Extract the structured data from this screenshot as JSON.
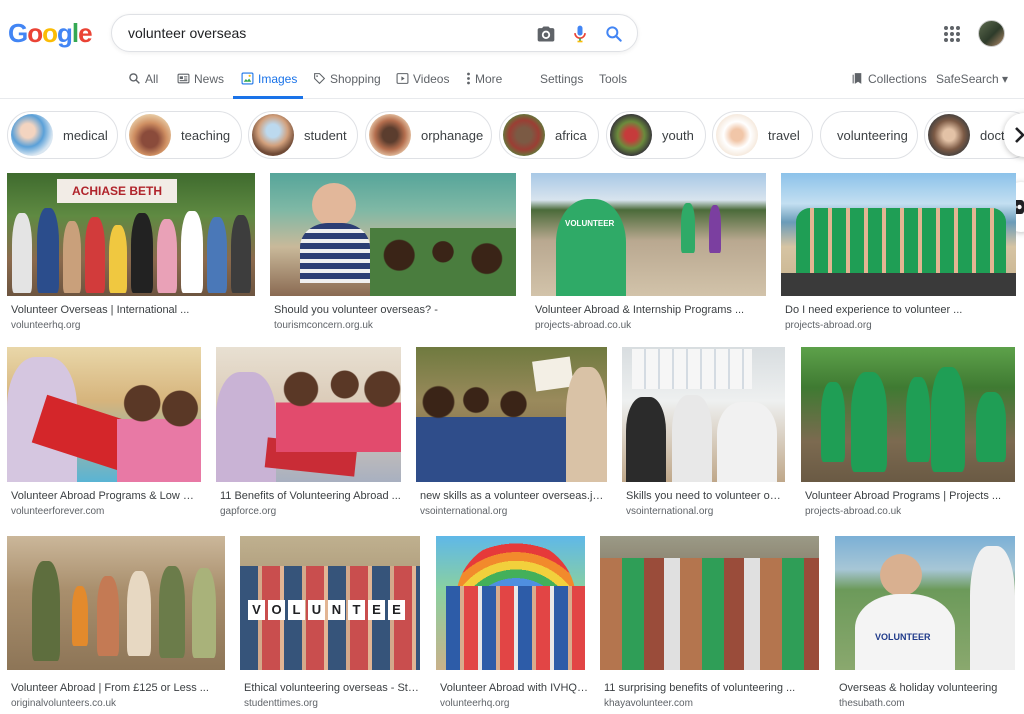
{
  "search": {
    "query": "volunteer overseas"
  },
  "logo": {
    "letters": [
      "G",
      "o",
      "o",
      "g",
      "l",
      "e"
    ],
    "colors": [
      "#4285f4",
      "#ea4335",
      "#fbbc05",
      "#4285f4",
      "#34a853",
      "#ea4335"
    ]
  },
  "tabs": [
    {
      "label": "All",
      "icon": "search-icon"
    },
    {
      "label": "News",
      "icon": "news-icon"
    },
    {
      "label": "Images",
      "icon": "image-icon",
      "active": true
    },
    {
      "label": "Shopping",
      "icon": "tag-icon"
    },
    {
      "label": "Videos",
      "icon": "play-icon"
    },
    {
      "label": "More",
      "icon": "more-vert-icon"
    },
    {
      "label": "Settings"
    },
    {
      "label": "Tools"
    }
  ],
  "right_tools": {
    "collections": "Collections",
    "safesearch": "SafeSearch ▾"
  },
  "chips": [
    {
      "label": "medical"
    },
    {
      "label": "teaching"
    },
    {
      "label": "student"
    },
    {
      "label": "orphanage"
    },
    {
      "label": "africa"
    },
    {
      "label": "youth"
    },
    {
      "label": "travel"
    },
    {
      "label": "volunteering"
    },
    {
      "label": "doct"
    }
  ],
  "results": [
    {
      "title": "Volunteer Overseas | International ...",
      "source": "volunteerhq.org"
    },
    {
      "title": "Should you volunteer overseas? -",
      "source": "tourismconcern.org.uk"
    },
    {
      "title": "Volunteer Abroad & Internship Programs ...",
      "source": "projects-abroad.co.uk"
    },
    {
      "title": "Do I need experience to volunteer ...",
      "source": "projects-abroad.org"
    },
    {
      "title": "Volunteer Abroad Programs & Low Cos...",
      "source": "volunteerforever.com"
    },
    {
      "title": "11 Benefits of Volunteering Abroad ...",
      "source": "gapforce.org"
    },
    {
      "title": "new skills as a volunteer overseas.jpg ...",
      "source": "vsointernational.org"
    },
    {
      "title": "Skills you need to volunteer over...",
      "source": "vsointernational.org"
    },
    {
      "title": "Volunteer Abroad Programs | Projects ...",
      "source": "projects-abroad.co.uk"
    },
    {
      "title": "Volunteer Abroad | From £125 or Less ...",
      "source": "originalvolunteers.co.uk"
    },
    {
      "title": "Ethical volunteering overseas - Stud...",
      "source": "studenttimes.org"
    },
    {
      "title": "Volunteer Abroad with IVHQ | ...",
      "source": "volunteerhq.org"
    },
    {
      "title": "11 surprising benefits of volunteering ...",
      "source": "khayavolunteer.com"
    },
    {
      "title": "Overseas & holiday volunteering",
      "source": "thesubath.com"
    }
  ],
  "image_text": {
    "banner_1": "ACHIASE BETH",
    "shirt_3": "VOLUNTEER",
    "letters_11": [
      "V",
      "O",
      "L",
      "U",
      "N",
      "T",
      "E",
      "E"
    ],
    "shirt_14": "VOLUNTEER"
  },
  "colors": {
    "accent": "#1a73e8",
    "volunteer_green": "#1f9e55"
  }
}
